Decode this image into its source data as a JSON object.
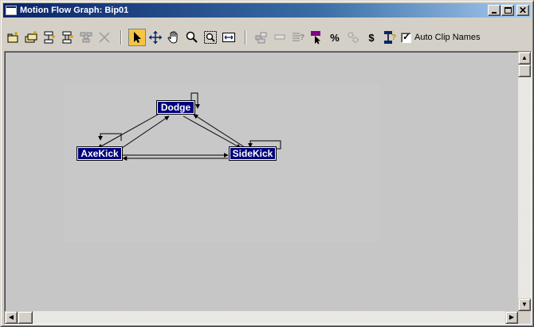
{
  "window": {
    "title": "Motion Flow Graph: Bip01"
  },
  "titlebar_buttons": [
    "minimize",
    "maximize",
    "close"
  ],
  "toolbar": {
    "group1": [
      {
        "name": "create-clip-icon"
      },
      {
        "name": "create-multiple-clips-icon"
      },
      {
        "name": "create-transition-icon"
      },
      {
        "name": "create-all-transitions-icon"
      },
      {
        "name": "delete-transition-icon"
      },
      {
        "name": "delete-icon"
      }
    ],
    "group2": [
      {
        "name": "select-arrow-icon",
        "active": true
      },
      {
        "name": "move-icon"
      },
      {
        "name": "pan-hand-icon"
      },
      {
        "name": "zoom-icon"
      },
      {
        "name": "zoom-region-icon"
      },
      {
        "name": "zoom-extents-icon"
      }
    ],
    "group3": [
      {
        "name": "show-scripts-icon"
      },
      {
        "name": "random-transition-icon"
      },
      {
        "name": "properties-icon"
      },
      {
        "name": "select-random-flag-icon"
      },
      {
        "name": "percent-icon",
        "glyph": "%"
      },
      {
        "name": "optimize-icon"
      },
      {
        "name": "dollar-icon",
        "glyph": "$"
      },
      {
        "name": "save-clip-icon"
      }
    ],
    "auto_clip_names": {
      "label": "Auto Clip Names",
      "checked": true
    }
  },
  "graph": {
    "nodes": [
      {
        "id": "dodge",
        "label": "Dodge"
      },
      {
        "id": "axekick",
        "label": "AxeKick"
      },
      {
        "id": "sidekick",
        "label": "SideKick"
      }
    ]
  },
  "colors": {
    "node_fill": "#00007b",
    "canvas": "#c6c6c6",
    "accent_active": "#f5c542"
  }
}
